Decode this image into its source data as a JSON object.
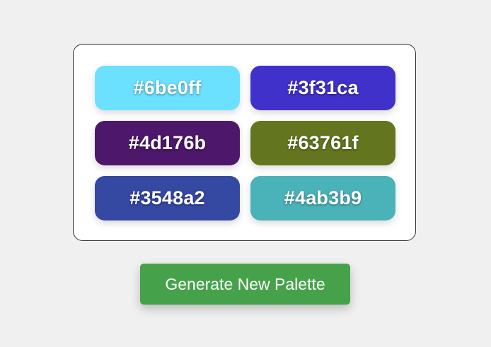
{
  "palette": {
    "swatches": [
      {
        "label": "#6be0ff",
        "color": "#6be0ff"
      },
      {
        "label": "#3f31ca",
        "color": "#3f31ca"
      },
      {
        "label": "#4d176b",
        "color": "#4d176b"
      },
      {
        "label": "#63761f",
        "color": "#63761f"
      },
      {
        "label": "#3548a2",
        "color": "#3548a2"
      },
      {
        "label": "#4ab3b9",
        "color": "#4ab3b9"
      }
    ]
  },
  "actions": {
    "generate_label": "Generate New Palette",
    "generate_color": "#46a24a"
  },
  "theme": {
    "background": "#f0f0f0",
    "card_background": "#ffffff",
    "card_border": "#333333"
  }
}
